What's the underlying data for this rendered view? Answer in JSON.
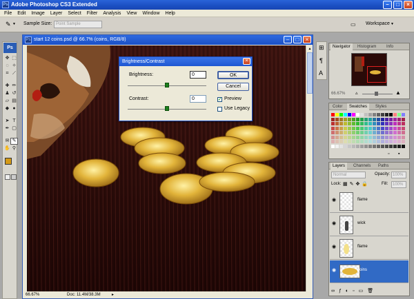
{
  "app": {
    "title": "Adobe Photoshop CS3 Extended",
    "logo": "Ps"
  },
  "menu": [
    "File",
    "Edit",
    "Image",
    "Layer",
    "Select",
    "Filter",
    "Analysis",
    "View",
    "Window",
    "Help"
  ],
  "options_bar": {
    "sample_size_label": "Sample Size:",
    "sample_size_value": "Point Sample",
    "workspace_label": "Workspace"
  },
  "document": {
    "title": "start 12 coins.psd @ 66.7% (coins, RGB/8)",
    "zoom": "66.67%",
    "doc_info": "Doc: 11.4M/38.3M"
  },
  "dialog": {
    "title": "Brightness/Contrast",
    "brightness_label": "Brightness:",
    "brightness_value": "0",
    "contrast_label": "Contrast:",
    "contrast_value": "0",
    "ok_label": "OK",
    "cancel_label": "Cancel",
    "preview_label": "Preview",
    "preview_checked": true,
    "legacy_label": "Use Legacy",
    "legacy_checked": false,
    "brightness_slider_level": 0.5,
    "contrast_slider_level": 0.5
  },
  "navigator_panel": {
    "tabs": [
      "Navigator",
      "Histogram",
      "Info"
    ],
    "zoom": "66.67%"
  },
  "swatches_panel": {
    "tabs": [
      "Color",
      "Swatches",
      "Styles"
    ]
  },
  "layers_panel": {
    "tabs": [
      "Layers",
      "Channels",
      "Paths"
    ],
    "blend_mode": "Normal",
    "opacity_label": "Opacity:",
    "opacity_value": "100%",
    "lock_label": "Lock:",
    "fill_label": "Fill:",
    "fill_value": "100%",
    "layers": [
      {
        "name": "flame",
        "selected": false
      },
      {
        "name": "wick",
        "selected": false
      },
      {
        "name": "flame",
        "selected": false
      },
      {
        "name": "coins",
        "selected": true
      }
    ]
  },
  "colors": {
    "titlebar": "#1f57c9",
    "selection": "#316ac5",
    "foreground_swatch": "#d49a17"
  }
}
